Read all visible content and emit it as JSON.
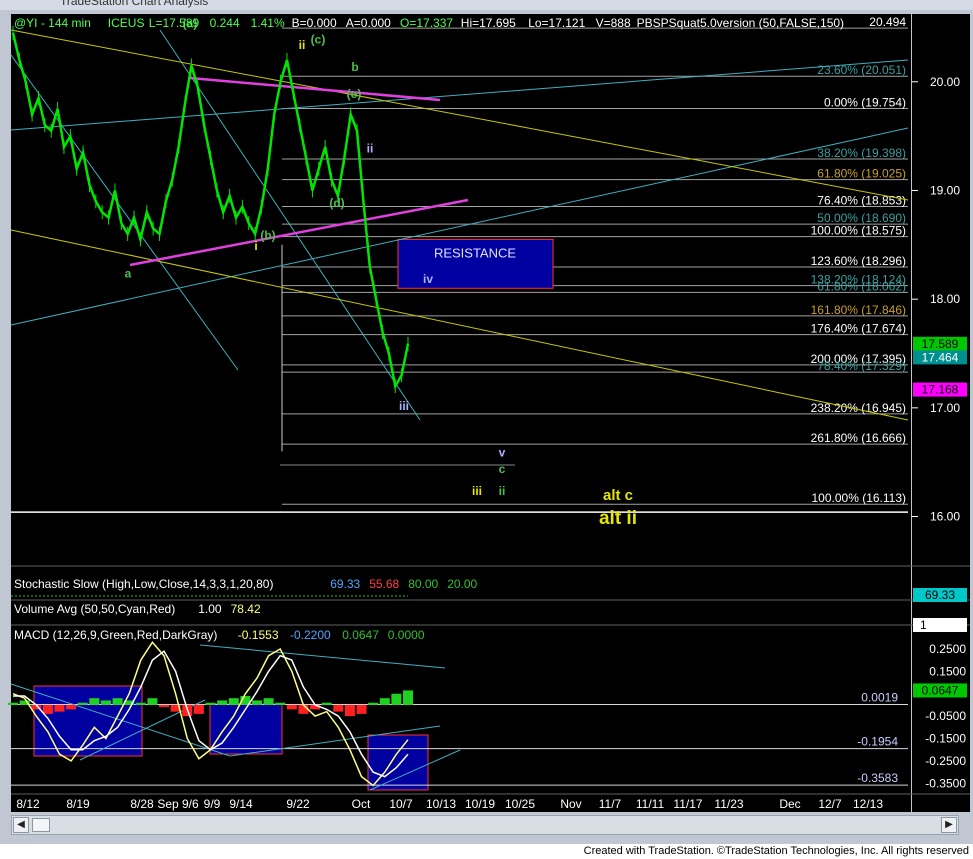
{
  "window": {
    "title": "TradeStation Chart Analysis"
  },
  "header": {
    "parts": [
      {
        "text": "@YI - 144 min",
        "color": "#4dff4d"
      },
      {
        "text": "ICEUS",
        "color": "#4dff4d"
      },
      {
        "text": "L=17.589",
        "color": "#4dff4d"
      },
      {
        "text": "0.244",
        "color": "#4dff4d"
      },
      {
        "text": "1.41%",
        "color": "#4dff4d"
      },
      {
        "text": "B=0.000",
        "color": "#ffffff"
      },
      {
        "text": "A=0.000",
        "color": "#ffffff"
      },
      {
        "text": "O=17.337",
        "color": "#4dff4d"
      },
      {
        "text": "Hi=17.695",
        "color": "#ffffff"
      },
      {
        "text": "Lo=17.121",
        "color": "#ffffff"
      },
      {
        "text": "V=888",
        "color": "#ffffff"
      },
      {
        "text": "PBSPSquat5.0version (50,FALSE,150)",
        "color": "#ffffff"
      }
    ]
  },
  "chart_data": [
    {
      "type": "line",
      "panel": "price",
      "ylim": [
        15.6,
        20.55
      ],
      "y_ticks": [
        "20.00",
        "19.00",
        "18.00",
        "17.00",
        "16.00"
      ],
      "price_tags": [
        {
          "text": "17.589",
          "value": 17.589,
          "bg": "#00c800",
          "fg": "#000000"
        },
        {
          "text": "17.464",
          "value": 17.464,
          "bg": "#008f8f",
          "fg": "#ffffff"
        },
        {
          "text": "17.168",
          "value": 17.168,
          "bg": "#ff00ff",
          "fg": "#000000"
        }
      ],
      "fib_levels": [
        {
          "label": "20.494",
          "value": 20.494,
          "color": "#ffffff"
        },
        {
          "label": "23.60% (20.051)",
          "value": 20.051,
          "color": "#3aa0a0"
        },
        {
          "label": "0.00% (19.754)",
          "value": 19.754,
          "color": "#ffffff"
        },
        {
          "label": "38.20% (19.398)",
          "value": 19.29,
          "color": "#3aa0a0"
        },
        {
          "label": "61.80% (19.025)",
          "value": 19.1,
          "color": "#c8a028"
        },
        {
          "label": "76.40% (18.853)",
          "value": 18.853,
          "color": "#ffffff"
        },
        {
          "label": "50.00% (18.690)",
          "value": 18.69,
          "color": "#3aa0a0"
        },
        {
          "label": "100.00% (18.575)",
          "value": 18.575,
          "color": "#ffffff"
        },
        {
          "label": "123.60% (18.296)",
          "value": 18.296,
          "color": "#ffffff"
        },
        {
          "label": "138.20% (18.124)",
          "value": 18.124,
          "color": "#3aa0a0"
        },
        {
          "label": "61.80% (18.062)",
          "value": 18.062,
          "color": "#3aa0a0"
        },
        {
          "label": "161.80% (17.846)",
          "value": 17.846,
          "color": "#c8a028"
        },
        {
          "label": "176.40% (17.674)",
          "value": 17.674,
          "color": "#ffffff"
        },
        {
          "label": "200.00% (17.395)",
          "value": 17.395,
          "color": "#ffffff"
        },
        {
          "label": "78.40% (17.329)",
          "value": 17.329,
          "color": "#3aa0a0"
        },
        {
          "label": "238.20% (16.945)",
          "value": 16.945,
          "color": "#ffffff"
        },
        {
          "label": "261.80% (16.666)",
          "value": 16.666,
          "color": "#ffffff"
        },
        {
          "label": "100.00% (16.113)",
          "value": 16.113,
          "color": "#ffffff"
        }
      ],
      "wave_labels": [
        {
          "text": "(a)",
          "color": "#4dbf4d",
          "x": "Sep 1",
          "y": 20.5
        },
        {
          "text": "ii",
          "color": "#e6e600",
          "x": "Sep 22",
          "y": 20.3
        },
        {
          "text": "(c)",
          "color": "#4dbf4d",
          "x": "Sep 23",
          "y": 20.35
        },
        {
          "text": "b",
          "color": "#4dbf4d",
          "x": "Sep 29",
          "y": 20.1
        },
        {
          "text": "(e)",
          "color": "#4dbf4d",
          "x": "Sep 30",
          "y": 19.85
        },
        {
          "text": "ii",
          "color": "#b0b0ff",
          "x": "Oct 3",
          "y": 19.35
        },
        {
          "text": "(d)",
          "color": "#4dbf4d",
          "x": "Sep 28",
          "y": 18.85
        },
        {
          "text": "i",
          "color": "#e6e600",
          "x": "Sep 12",
          "y": 18.45
        },
        {
          "text": "(b)",
          "color": "#4dbf4d",
          "x": "Sep 14",
          "y": 18.55
        },
        {
          "text": "a",
          "color": "#4dbf4d",
          "x": "Aug 26",
          "y": 18.2
        },
        {
          "text": "iv",
          "color": "#b0b0ff",
          "x": "Oct 5",
          "y": 18.15
        },
        {
          "text": "iii",
          "color": "#b0b0ff",
          "x": "Oct 7",
          "y": 16.98
        },
        {
          "text": "v",
          "color": "#b0b0ff",
          "x": "Oct 15",
          "y": 16.55
        },
        {
          "text": "c",
          "color": "#4dbf4d",
          "x": "Oct 15",
          "y": 16.4
        },
        {
          "text": "iii",
          "color": "#e6e600",
          "x": "Oct 13",
          "y": 16.2
        },
        {
          "text": "ii",
          "color": "#4dbf4d",
          "x": "Oct 15",
          "y": 16.2
        },
        {
          "text": "alt c",
          "color": "#e6e600",
          "x": "Nov 7",
          "y": 16.15
        },
        {
          "text": "alt ii",
          "color": "#e6e600",
          "x": "Nov 7",
          "y": 15.93
        }
      ],
      "zone": {
        "label": "RESISTANCE",
        "low": 18.1,
        "high": 18.55,
        "color": "#0000a0"
      },
      "series": [
        {
          "name": "price",
          "color": "#00e600",
          "values": [
            20.45,
            20.2,
            20.0,
            19.7,
            19.85,
            19.6,
            19.55,
            19.75,
            19.4,
            19.5,
            19.2,
            19.35,
            19.05,
            18.9,
            18.8,
            18.75,
            19.0,
            18.7,
            18.6,
            18.75,
            18.55,
            18.8,
            18.65,
            18.6,
            18.9,
            19.1,
            19.4,
            19.8,
            20.15,
            19.95,
            19.6,
            19.3,
            19.0,
            18.8,
            18.95,
            18.75,
            18.85,
            18.7,
            18.6,
            18.85,
            19.2,
            19.7,
            20.0,
            20.2,
            19.9,
            19.6,
            19.3,
            19.0,
            19.2,
            19.4,
            19.1,
            18.95,
            19.3,
            19.7,
            19.55,
            18.9,
            18.3,
            18.0,
            17.7,
            17.5,
            17.2,
            17.3,
            17.589
          ]
        }
      ]
    },
    {
      "type": "line",
      "panel": "stochastic",
      "legend": [
        "Stochastic Slow (High,Low,Close,14,3,3,1,20,80)",
        "69.33",
        "55.68",
        "80.00",
        "20.00"
      ],
      "tag": "69.33"
    },
    {
      "type": "bar",
      "panel": "volume",
      "legend": [
        "Volume Avg (50,50,Cyan,Red)",
        "1.00",
        "78.42"
      ],
      "tag": "1"
    },
    {
      "type": "line",
      "panel": "macd",
      "legend": [
        "MACD (12,26,9,Green,Red,DarkGray)",
        "-0.1553",
        "-0.2200",
        "0.0647",
        "0.0000"
      ],
      "ylim": [
        -0.38,
        0.29
      ],
      "y_ticks": [
        "0.2500",
        "0.1500",
        "0.0500",
        "-0.0500",
        "-0.1500",
        "-0.2500",
        "-0.3500"
      ],
      "levels": [
        {
          "label": "0.0019",
          "value": 0.0019
        },
        {
          "label": "-0.1954",
          "value": -0.1954
        },
        {
          "label": "-0.3583",
          "value": -0.3583
        }
      ],
      "tag": {
        "text": "0.0647",
        "value": 0.0647
      },
      "series": [
        {
          "name": "MACD",
          "color": "#ffff80",
          "values": [
            0.05,
            0.03,
            -0.05,
            -0.12,
            -0.22,
            -0.25,
            -0.18,
            -0.1,
            -0.15,
            -0.05,
            0.05,
            0.2,
            0.28,
            0.22,
            0.05,
            -0.15,
            -0.24,
            -0.2,
            -0.12,
            -0.05,
            0.05,
            0.12,
            0.22,
            0.25,
            0.15,
            0.0,
            -0.05,
            -0.03,
            -0.1,
            -0.2,
            -0.32,
            -0.36,
            -0.3,
            -0.22,
            -0.1553
          ]
        },
        {
          "name": "Avg",
          "color": "#ffffff",
          "values": [
            0.04,
            0.04,
            0.0,
            -0.06,
            -0.14,
            -0.2,
            -0.2,
            -0.16,
            -0.14,
            -0.1,
            -0.02,
            0.08,
            0.2,
            0.24,
            0.15,
            -0.02,
            -0.16,
            -0.2,
            -0.17,
            -0.1,
            -0.02,
            0.06,
            0.15,
            0.22,
            0.2,
            0.08,
            0.0,
            -0.02,
            -0.05,
            -0.12,
            -0.22,
            -0.3,
            -0.32,
            -0.28,
            -0.22
          ]
        }
      ],
      "histogram": [
        0.01,
        0.02,
        -0.02,
        -0.04,
        -0.03,
        -0.02,
        0.01,
        0.03,
        0.02,
        0.03,
        0.02,
        0.01,
        0.03,
        -0.01,
        -0.03,
        -0.05,
        -0.04,
        0.01,
        0.02,
        0.03,
        0.04,
        0.02,
        0.03,
        0.01,
        -0.02,
        -0.04,
        -0.02,
        0.01,
        -0.03,
        -0.05,
        -0.04,
        0.01,
        0.03,
        0.05,
        0.0647
      ]
    }
  ],
  "x_axis": {
    "labels": [
      "8/12",
      "8/19",
      "8/28",
      "Sep 9/6",
      "9/9",
      "9/14",
      "9/22",
      "Oct",
      "10/7",
      "10/13",
      "10/19",
      "10/25",
      "Nov",
      "11/7",
      "11/11",
      "11/17",
      "11/23",
      "Dec",
      "12/7",
      "12/13"
    ]
  },
  "footer": {
    "text": "Created with TradeStation. ©TradeStation Technologies, Inc. All rights reserved"
  },
  "scrollbar": {
    "left_icon": "chevron-left-icon",
    "right_icon": "chevron-right-icon"
  }
}
